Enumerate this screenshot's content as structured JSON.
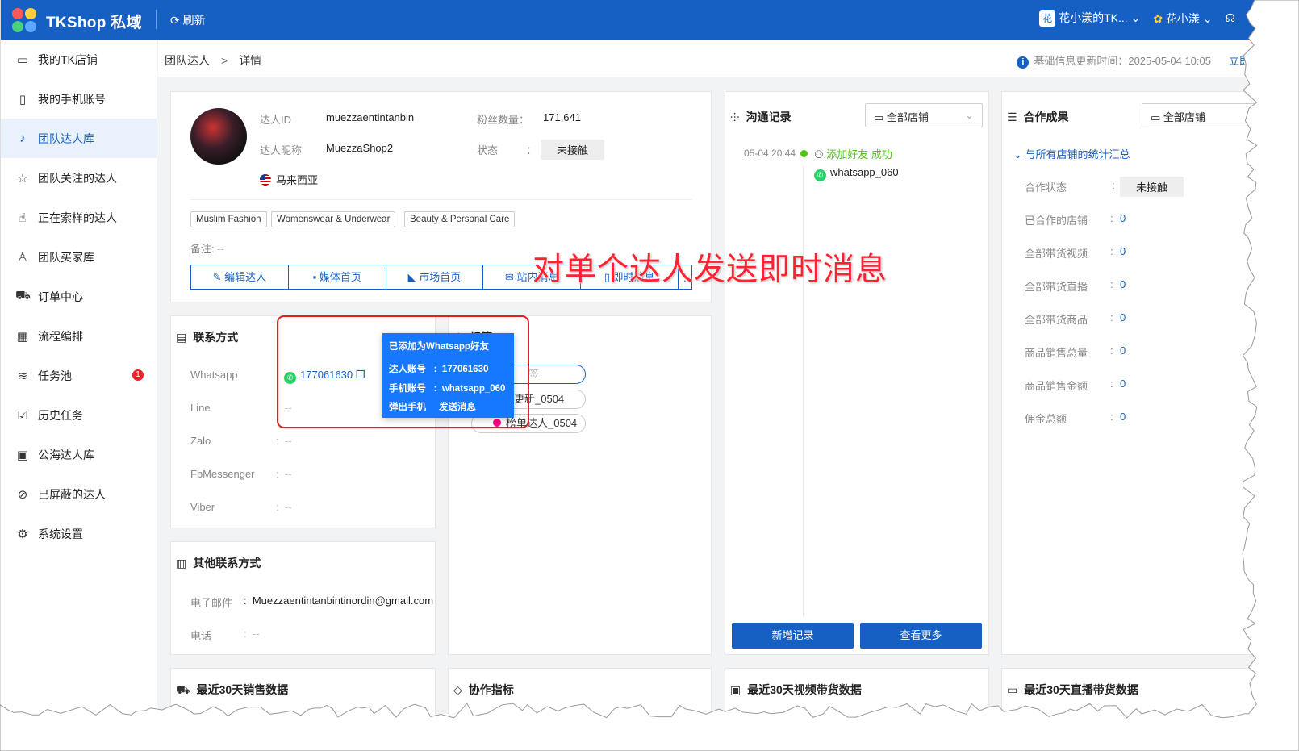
{
  "header": {
    "brand": "TKShop 私域",
    "refresh": "刷新",
    "team_chip": "花",
    "team_name": "花小漾的TK...",
    "user_name": "花小漾"
  },
  "sidebar": {
    "items": [
      {
        "label": "我的TK店铺",
        "icon": "store-icon"
      },
      {
        "label": "我的手机账号",
        "icon": "phone-icon"
      },
      {
        "label": "团队达人库",
        "icon": "tiktok-icon",
        "active": true
      },
      {
        "label": "团队关注的达人",
        "icon": "star-icon"
      },
      {
        "label": "正在索样的达人",
        "icon": "hand-icon"
      },
      {
        "label": "团队买家库",
        "icon": "user-icon"
      },
      {
        "label": "订单中心",
        "icon": "truck-icon"
      },
      {
        "label": "流程编排",
        "icon": "calendar-icon"
      },
      {
        "label": "任务池",
        "icon": "layers-icon",
        "badge": "1"
      },
      {
        "label": "历史任务",
        "icon": "checklist-icon"
      },
      {
        "label": "公海达人库",
        "icon": "public-icon"
      },
      {
        "label": "已屏蔽的达人",
        "icon": "block-icon"
      },
      {
        "label": "系统设置",
        "icon": "gear-icon"
      }
    ]
  },
  "breadcrumb": {
    "parent": "团队达人",
    "sep": ">",
    "current": "详情"
  },
  "update_info": {
    "text": "基础信息更新时间：2025-05-04 10:05",
    "link": "立即"
  },
  "profile": {
    "id_label": "达人ID",
    "id_value": "muezzaentintanbin",
    "nick_label": "达人昵称",
    "nick_value": "MuezzaShop2",
    "fans_label": "粉丝数量",
    "fans_value": "171,641",
    "status_label": "状态",
    "status_value": "未接触",
    "country": "马来西亚",
    "tags": [
      "Muslim Fashion",
      "Womenswear & Underwear",
      "Beauty & Personal Care"
    ],
    "remark_label": "备注:",
    "remark_value": "--",
    "actions": [
      "编辑达人",
      "媒体首页",
      "市场首页",
      "站内消息",
      "即时消息"
    ]
  },
  "contact": {
    "title": "联系方式",
    "rows": [
      {
        "label": "Whatsapp",
        "value": "177061630"
      },
      {
        "label": "Line",
        "value": "--"
      },
      {
        "label": "Zalo",
        "value": "--"
      },
      {
        "label": "FbMessenger",
        "value": "--"
      },
      {
        "label": "Viber",
        "value": "--"
      }
    ]
  },
  "labels_panel": {
    "title": "标签",
    "add_placeholder": "签",
    "pills": [
      "更新_0504",
      "榜单达人_0504"
    ]
  },
  "other_contact": {
    "title": "其他联系方式",
    "email_label": "电子邮件",
    "email_value": "Muezzaentintanbintinordin@gmail.com",
    "phone_label": "电话",
    "phone_value": "--"
  },
  "comm": {
    "title": "沟通记录",
    "filter": "全部店铺",
    "entries": [
      {
        "time": "05-04 20:44",
        "action": "添加好友 成功",
        "account": "whatsapp_060"
      }
    ],
    "btn_add": "新增记录",
    "btn_more": "查看更多"
  },
  "coop": {
    "title": "合作成果",
    "filter": "全部店铺",
    "summary": "与所有店铺的统计汇总",
    "status_label": "合作状态",
    "status_value": "未接触",
    "stats": [
      {
        "label": "已合作的店铺",
        "value": "0"
      },
      {
        "label": "全部带货视频",
        "value": "0"
      },
      {
        "label": "全部带货直播",
        "value": "0"
      },
      {
        "label": "全部带货商品",
        "value": "0"
      },
      {
        "label": "商品销售总量",
        "value": "0"
      },
      {
        "label": "商品销售金额",
        "value": "0"
      },
      {
        "label": "佣金总额",
        "value": "0"
      }
    ]
  },
  "bottom_panels": [
    "最近30天销售数据",
    "协作指标",
    "最近30天视频带货数据",
    "最近30天直播带货数据"
  ],
  "tooltip": {
    "title": "已添加为Whatsapp好友",
    "creator_label": "达人账号",
    "creator_value": "177061630",
    "phone_label": "手机账号",
    "phone_value": "whatsapp_060",
    "link_popup": "弹出手机",
    "link_send": "发送消息"
  },
  "annotation": "对单个达人发送即时消息",
  "colors": {
    "primary": "#1660c4",
    "success": "#52c41a",
    "annotation": "#ff2233"
  }
}
